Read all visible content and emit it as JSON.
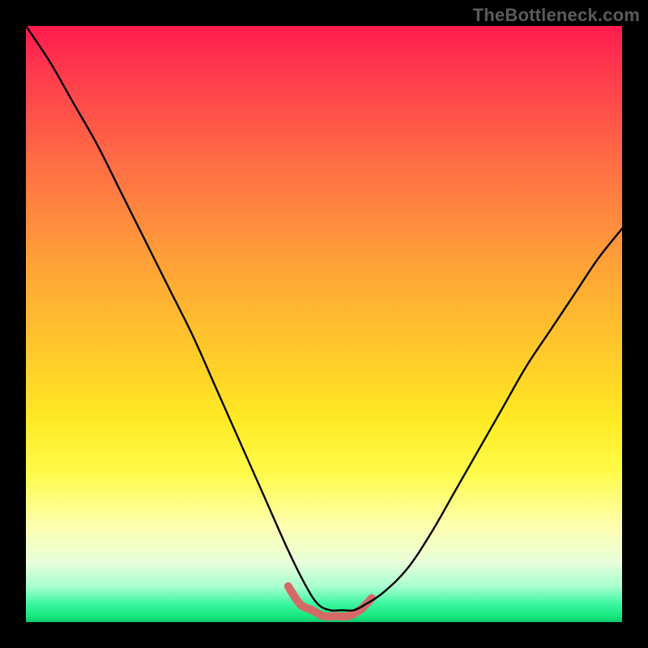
{
  "watermark": "TheBottleneck.com",
  "colors": {
    "frame_bg": "#000000",
    "curve": "#000000",
    "accent": "#d46a66",
    "gradient_top": "#ff1a4f",
    "gradient_mid": "#ffd028",
    "gradient_bottom": "#18e87d"
  },
  "chart_data": {
    "type": "line",
    "title": "",
    "xlabel": "",
    "ylabel": "",
    "xlim": [
      0,
      100
    ],
    "ylim": [
      0,
      100
    ],
    "grid": false,
    "legend": false,
    "annotations": [],
    "series": [
      {
        "name": "main-curve",
        "x": [
          0,
          4,
          8,
          12,
          16,
          20,
          24,
          28,
          32,
          36,
          40,
          44,
          47,
          49,
          51,
          53,
          55,
          57,
          60,
          64,
          68,
          72,
          76,
          80,
          84,
          88,
          92,
          96,
          100
        ],
        "y": [
          100,
          94,
          87,
          80,
          72,
          64,
          56,
          48,
          39,
          30,
          21,
          12,
          6,
          3,
          2,
          2,
          2,
          3,
          5,
          9,
          15,
          22,
          29,
          36,
          43,
          49,
          55,
          61,
          66
        ]
      },
      {
        "name": "accent-bottom",
        "x": [
          44,
          46,
          48,
          50,
          52,
          54,
          56,
          58
        ],
        "y": [
          6,
          3,
          2,
          1,
          1,
          1,
          2,
          4
        ]
      }
    ]
  }
}
